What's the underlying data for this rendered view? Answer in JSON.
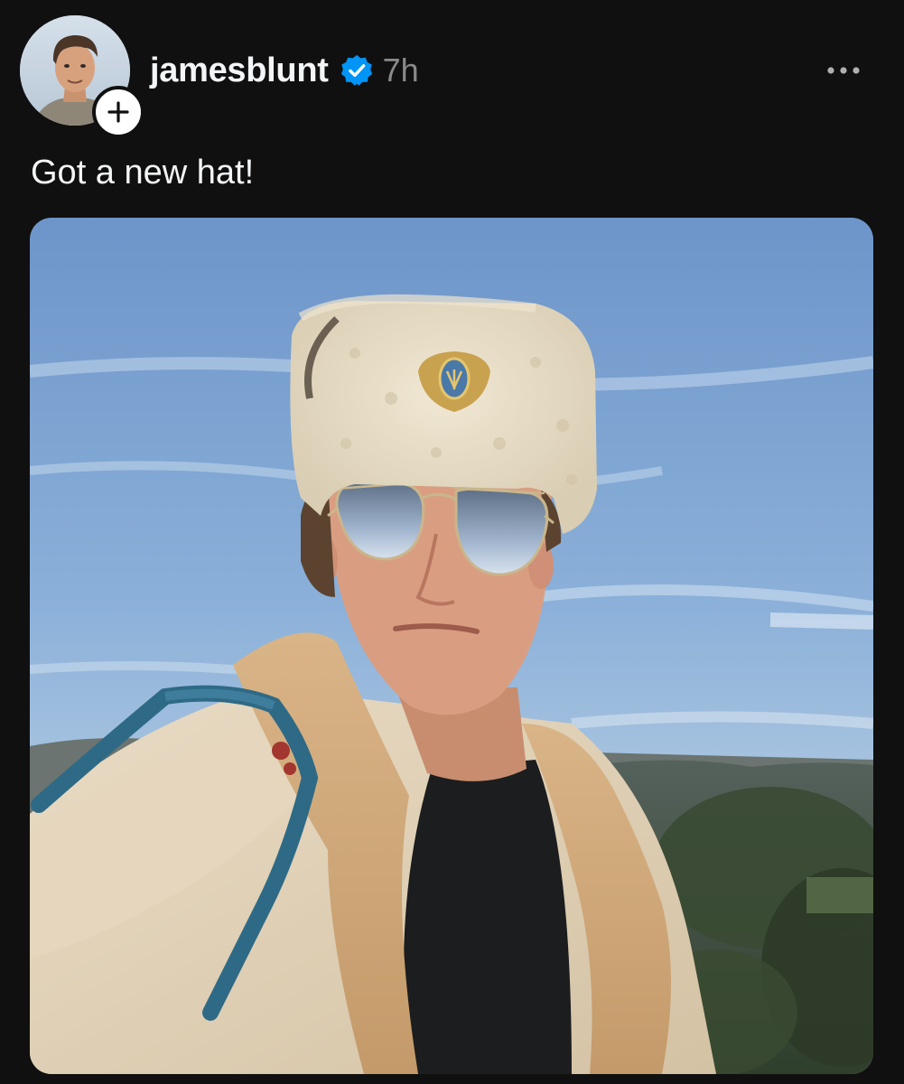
{
  "post": {
    "username": "jamesblunt",
    "verified": true,
    "timestamp": "7h",
    "caption": "Got a new hat!"
  },
  "icons": {
    "verified": "verified-badge-icon",
    "follow": "plus-icon",
    "more": "more-horizontal-icon"
  },
  "colors": {
    "background": "#101010",
    "text_primary": "#f3f5f7",
    "text_secondary": "#8a8a8a",
    "verified_blue": "#0095f6"
  }
}
